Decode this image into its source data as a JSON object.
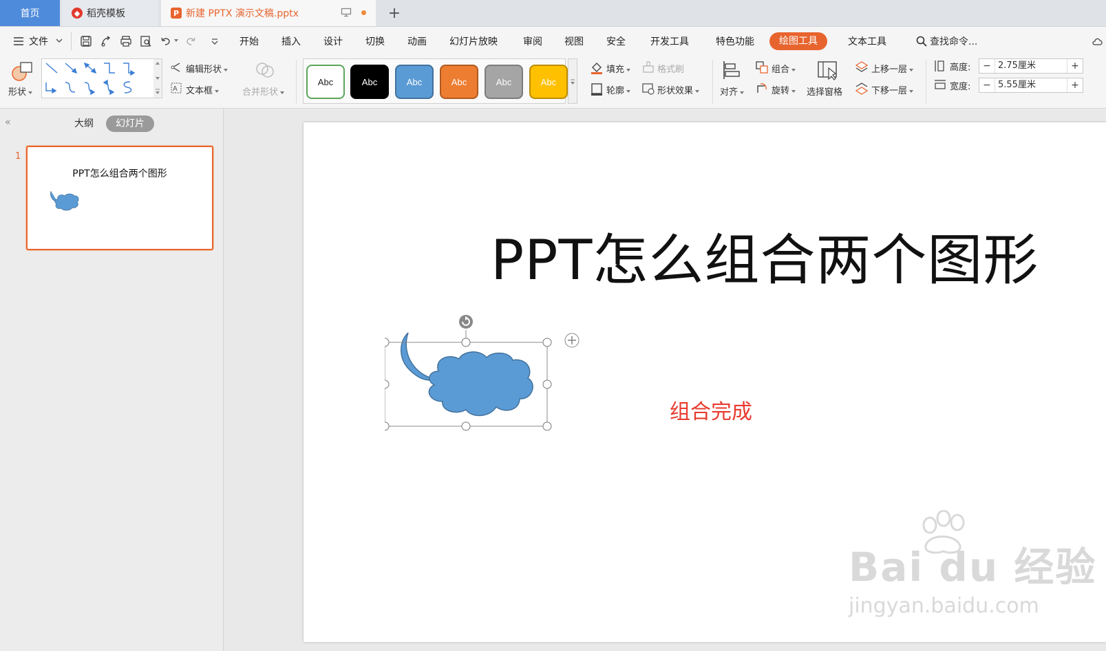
{
  "tabs": {
    "home": "首页",
    "template": "稻壳模板",
    "document": "新建 PPTX 演示文稿.pptx",
    "new_tab": "+"
  },
  "menu": {
    "file": "文件",
    "items": [
      "开始",
      "插入",
      "设计",
      "切换",
      "动画",
      "幻灯片放映",
      "审阅",
      "视图",
      "安全",
      "开发工具",
      "特色功能"
    ],
    "active": "绘图工具",
    "text_tools": "文本工具",
    "search_placeholder": "查找命令..."
  },
  "ribbon": {
    "shape_label": "形状",
    "edit_shape": "编辑形状",
    "text_box": "文本框",
    "merge_shape": "合并形状",
    "style_swatches": [
      {
        "label": "Abc",
        "bg": "#ffffff",
        "border": "#5aa55a",
        "color": "#222222"
      },
      {
        "label": "Abc",
        "bg": "#000000",
        "border": "#000000",
        "color": "#ffffff"
      },
      {
        "label": "Abc",
        "bg": "#5b9bd5",
        "border": "#41719c",
        "color": "#ffffff"
      },
      {
        "label": "Abc",
        "bg": "#ed7d31",
        "border": "#ae5a21",
        "color": "#ffffff"
      },
      {
        "label": "Abc",
        "bg": "#a5a5a5",
        "border": "#7c7c7c",
        "color": "#ffffff"
      },
      {
        "label": "Abc",
        "bg": "#ffc000",
        "border": "#bc8c00",
        "color": "#ffffff"
      }
    ],
    "fill": "填充",
    "format_painter": "格式刷",
    "outline": "轮廓",
    "shape_effect": "形状效果",
    "align": "对齐",
    "group": "组合",
    "rotate": "旋转",
    "selection_pane": "选择窗格",
    "bring_forward": "上移一层",
    "send_backward": "下移一层",
    "height_label": "高度:",
    "height_value": "2.75厘米",
    "width_label": "宽度:",
    "width_value": "5.55厘米",
    "minus": "−",
    "plus": "+"
  },
  "left_panel": {
    "outline_tab": "大纲",
    "slides_tab": "幻灯片",
    "slide_number": "1",
    "thumb_title": "PPT怎么组合两个图形"
  },
  "slide": {
    "title": "PPT怎么组合两个图形",
    "caption": "组合完成",
    "shape_fill": "#5b9bd5",
    "shape_stroke": "#41719c"
  },
  "watermark": {
    "logo_text": "Bai du 经验",
    "url": "jingyan.baidu.com"
  },
  "colors": {
    "accent": "#e8642e",
    "tab_home": "#4f8bdb",
    "caption_red": "#e83a2e"
  }
}
